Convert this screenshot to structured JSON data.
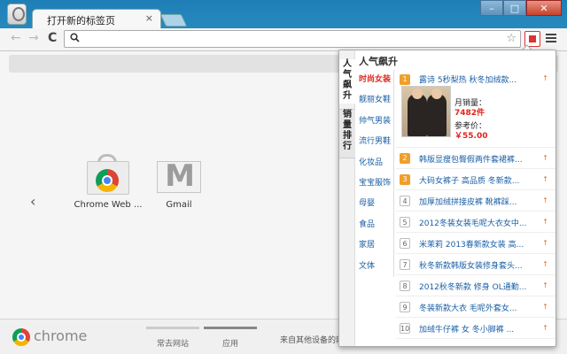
{
  "tab": {
    "title": "打开新的标签页",
    "close": "×"
  },
  "window": {
    "minimize": "–",
    "maximize": "□",
    "close": "✕"
  },
  "toolbar": {
    "back": "←",
    "forward": "→",
    "reload": "C",
    "search_icon": "search-icon",
    "star": "☆"
  },
  "apps": [
    {
      "label": "Chrome Web ...",
      "icon": "chrome-web-store-icon"
    },
    {
      "label": "Gmail",
      "icon": "gmail-icon"
    }
  ],
  "pager": {
    "prev": "‹"
  },
  "footer": {
    "brand": "chrome",
    "tabs": [
      "常去网站",
      "应用"
    ],
    "other_devices": "来自其他设备的网"
  },
  "popup": {
    "side_tabs": [
      "人气飙升",
      "销量排行"
    ],
    "title": "人气飙升",
    "categories": [
      "时尚女装",
      "靓丽女鞋",
      "帅气男装",
      "流行男鞋",
      "化妆品",
      "宝宝服饰",
      "母婴",
      "食品",
      "家居",
      "文体"
    ],
    "active_category": 0,
    "featured": {
      "rank": "1",
      "title": "露诗 5秒梨热 秋冬加绒款...",
      "sales_label": "月销量：",
      "sales_value": "7482件",
      "price_label": "参考价：",
      "price_value": "￥55.00"
    },
    "items": [
      {
        "rank": "2",
        "title": "韩版显瘦包臀假两件套裙裤..."
      },
      {
        "rank": "3",
        "title": "大码女裤子 高品质 冬新款..."
      },
      {
        "rank": "4",
        "title": "加厚加绒拼接皮裤 靴裤踩..."
      },
      {
        "rank": "5",
        "title": "2012冬装女装毛呢大衣女中..."
      },
      {
        "rank": "6",
        "title": "米茉莉 2013春新款女装 高..."
      },
      {
        "rank": "7",
        "title": "秋冬新款韩版女装修身套头..."
      },
      {
        "rank": "8",
        "title": "2012秋冬新款 修身 OL通勤..."
      },
      {
        "rank": "9",
        "title": "冬装新款大衣 毛呢外套女..."
      },
      {
        "rank": "10",
        "title": "加绒牛仔裤 女 冬小脚裤 ..."
      }
    ],
    "trend_icon": "↑"
  },
  "colors": {
    "accent_red": "#e1251b",
    "link_blue": "#1a5fa6",
    "rank_orange": "#ef9f2a"
  }
}
